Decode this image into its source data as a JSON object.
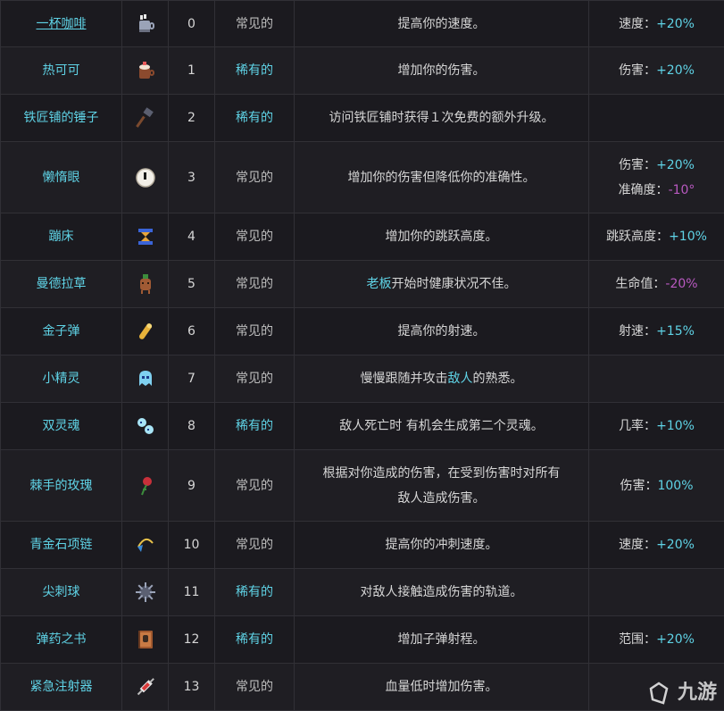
{
  "rows": [
    {
      "name": "一杯咖啡",
      "id": "0",
      "rarity": "常见的",
      "desc": "提高你的速度。",
      "stat1_label": "速度：",
      "stat1_val": "+20%",
      "icon": "coffee-cup-icon"
    },
    {
      "name": "热可可",
      "id": "1",
      "rarity": "稀有的",
      "desc": "增加你的伤害。",
      "stat1_label": "伤害：",
      "stat1_val": "+20%",
      "icon": "hot-cocoa-icon"
    },
    {
      "name": "铁匠铺的锤子",
      "id": "2",
      "rarity": "稀有的",
      "desc": "访问铁匠铺时获得１次免费的额外升级。",
      "icon": "hammer-icon"
    },
    {
      "name": "懒惰眼",
      "id": "3",
      "rarity": "常见的",
      "desc": "增加你的伤害但降低你的准确性。",
      "stat1_label": "伤害：",
      "stat1_val": "+20%",
      "stat2_label": "准确度：",
      "stat2_val": "-10°",
      "icon": "eye-icon"
    },
    {
      "name": "蹦床",
      "id": "4",
      "rarity": "常见的",
      "desc": "增加你的跳跃高度。",
      "stat1_label": "跳跃高度：",
      "stat1_val": "+10%",
      "icon": "trampoline-icon"
    },
    {
      "name": "曼德拉草",
      "id": "5",
      "rarity": "常见的",
      "desc_hl": "老板",
      "desc_rest": "开始时健康状况不佳。",
      "stat1_label": "生命值：",
      "stat1_val": "-20%",
      "icon": "mandrake-icon"
    },
    {
      "name": "金子弹",
      "id": "6",
      "rarity": "常见的",
      "desc": "提高你的射速。",
      "stat1_label": "射速：",
      "stat1_val": "+15%",
      "icon": "golden-bullet-icon"
    },
    {
      "name": "小精灵",
      "id": "7",
      "rarity": "常见的",
      "desc_pre": "慢慢跟随并攻击",
      "desc_hl": "敌人",
      "desc_post": "的熟悉。",
      "icon": "spirit-icon"
    },
    {
      "name": "双灵魂",
      "id": "8",
      "rarity": "稀有的",
      "desc": "敌人死亡时 有机会生成第二个灵魂。",
      "stat1_label": "几率：",
      "stat1_val": "+10%",
      "icon": "twin-souls-icon"
    },
    {
      "name": "棘手的玫瑰",
      "id": "9",
      "rarity": "常见的",
      "desc_l1": "根据对你造成的伤害，在受到伤害时对所有",
      "desc_l2": "敌人造成伤害。",
      "stat1_label": "伤害：",
      "stat1_val": "100%",
      "icon": "rose-icon"
    },
    {
      "name": "青金石项链",
      "id": "10",
      "rarity": "常见的",
      "desc": "提高你的冲刺速度。",
      "stat1_label": "速度：",
      "stat1_val": "+20%",
      "icon": "necklace-icon"
    },
    {
      "name": "尖刺球",
      "id": "11",
      "rarity": "稀有的",
      "desc": "对敌人接触造成伤害的轨道。",
      "icon": "spiked-ball-icon"
    },
    {
      "name": "弹药之书",
      "id": "12",
      "rarity": "稀有的",
      "desc": "增加子弹射程。",
      "stat1_label": "范围：",
      "stat1_val": "+20%",
      "icon": "ammo-book-icon"
    },
    {
      "name": "紧急注射器",
      "id": "13",
      "rarity": "常见的",
      "desc": "血量低时增加伤害。",
      "icon": "syringe-icon"
    }
  ],
  "watermark": "九游"
}
